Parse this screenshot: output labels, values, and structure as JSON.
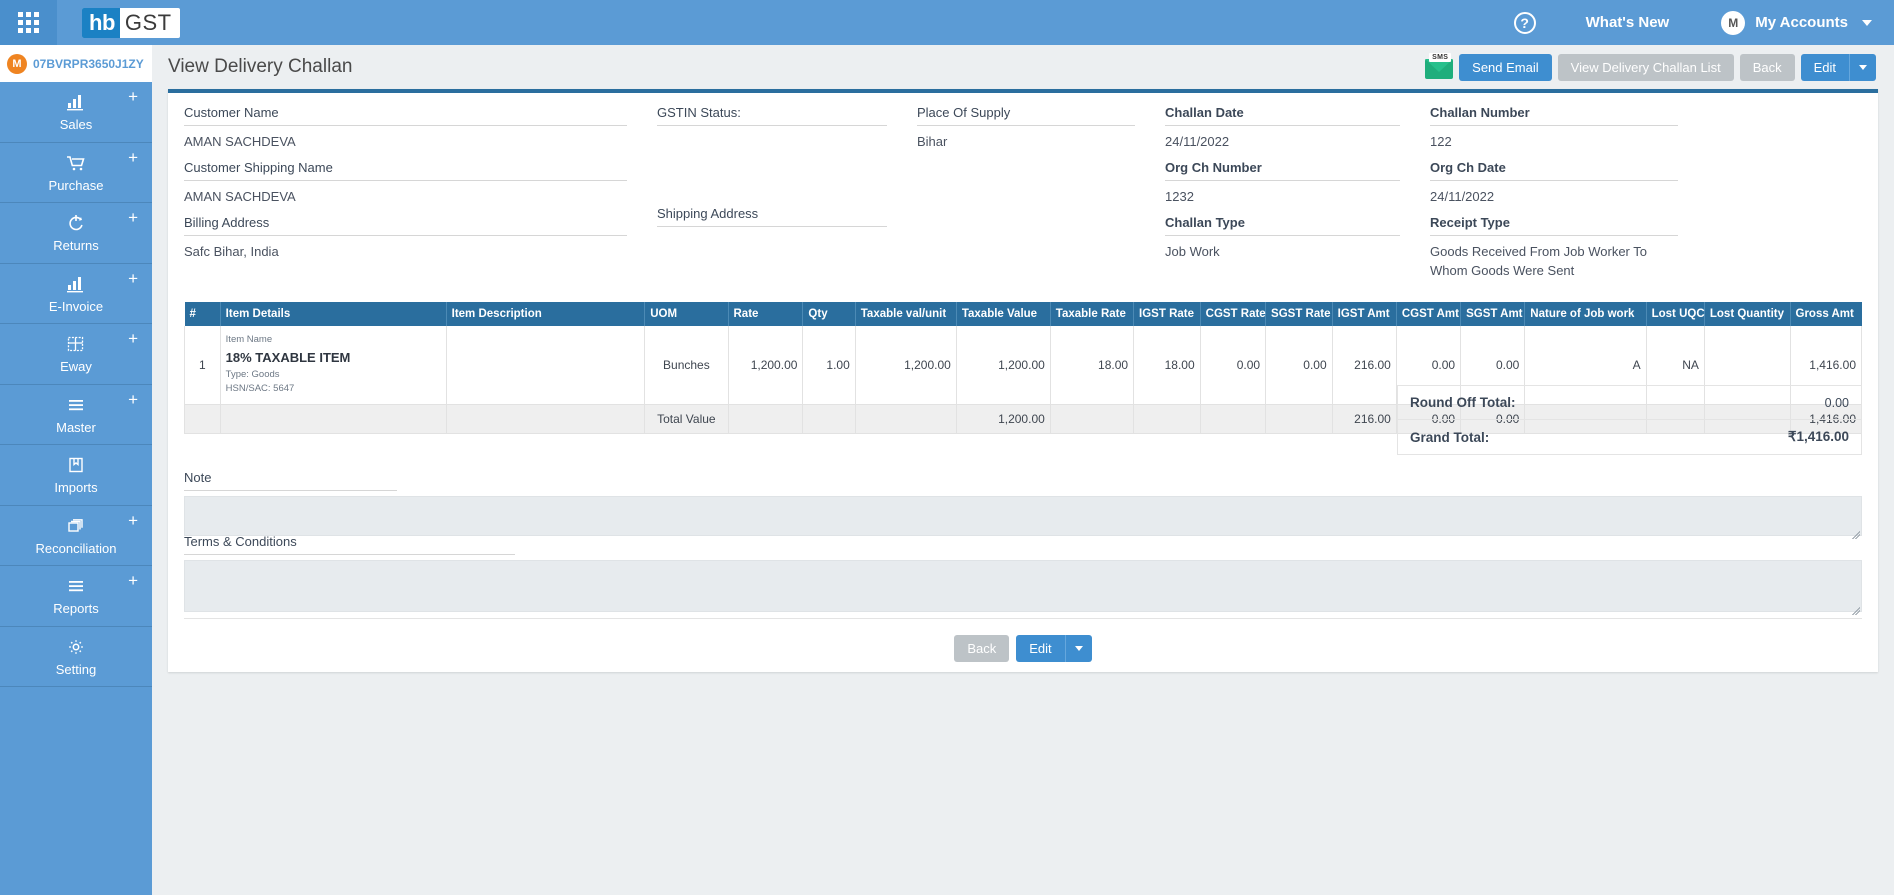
{
  "topbar": {
    "apps_icon": "grid-apps-icon",
    "logo_primary": "hb",
    "logo_secondary": "GST",
    "help_icon": "?",
    "whats_new": "What's New",
    "account_initial": "M",
    "account_label": "My Accounts",
    "accent": "#5b9bd5"
  },
  "sidebar": {
    "gstin": "07BVRPR3650J1ZY",
    "gstin_initial": "M",
    "items": [
      {
        "label": "Sales",
        "icon": "bar-chart-icon",
        "has_add": true
      },
      {
        "label": "Purchase",
        "icon": "cart-icon",
        "has_add": true
      },
      {
        "label": "Returns",
        "icon": "refresh-icon",
        "has_add": true
      },
      {
        "label": "E-Invoice",
        "icon": "bar-chart-icon",
        "has_add": true
      },
      {
        "label": "Eway",
        "icon": "grid-table-icon",
        "has_add": true
      },
      {
        "label": "Master",
        "icon": "hamburger-icon",
        "has_add": true
      },
      {
        "label": "Imports",
        "icon": "bookmark-icon",
        "has_add": false
      },
      {
        "label": "Reconciliation",
        "icon": "copy-icon",
        "has_add": true
      },
      {
        "label": "Reports",
        "icon": "hamburger-icon",
        "has_add": true
      },
      {
        "label": "Setting",
        "icon": "gear-icon",
        "has_add": false
      }
    ],
    "add_symbol": "+"
  },
  "header": {
    "title": "View Delivery Challan",
    "sms_badge": "SMS",
    "send_email": "Send Email",
    "view_list": "View Delivery Challan List",
    "back": "Back",
    "edit": "Edit"
  },
  "fields": {
    "customer_name_label": "Customer Name",
    "customer_name_value": "AMAN SACHDEVA",
    "customer_shipping_name_label": "Customer Shipping Name",
    "customer_shipping_name_value": "AMAN SACHDEVA",
    "billing_address_label": "Billing Address",
    "billing_address_value": "Safc Bihar, India",
    "gstin_status_label": "GSTIN Status:",
    "gstin_status_value": "",
    "shipping_address_label": "Shipping Address",
    "shipping_address_value": "",
    "place_of_supply_label": "Place Of Supply",
    "place_of_supply_value": "Bihar",
    "challan_date_label": "Challan Date",
    "challan_date_value": "24/11/2022",
    "org_ch_number_label": "Org Ch Number",
    "org_ch_number_value": "1232",
    "challan_type_label": "Challan Type",
    "challan_type_value": "Job Work",
    "challan_number_label": "Challan Number",
    "challan_number_value": "122",
    "org_ch_date_label": "Org Ch Date",
    "org_ch_date_value": "24/11/2022",
    "receipt_type_label": "Receipt Type",
    "receipt_type_value": "Goods Received From Job Worker To Whom Goods Were Sent"
  },
  "table": {
    "columns": [
      "#",
      "Item Details",
      "Item Description",
      "UOM",
      "Rate",
      "Qty",
      "Taxable val/unit",
      "Taxable Value",
      "Taxable Rate",
      "IGST Rate",
      "CGST Rate",
      "SGST Rate",
      "IGST Amt",
      "CGST Amt",
      "SGST Amt",
      "Nature of Job work",
      "Lost UQC",
      "Lost Quantity",
      "Gross Amt"
    ],
    "rows": [
      {
        "index": "1",
        "item_name_caption": "Item Name",
        "item_name": "18% TAXABLE ITEM",
        "item_type": "Type: Goods",
        "item_hsn": "HSN/SAC: 5647",
        "item_description": "",
        "uom": "Bunches",
        "rate": "1,200.00",
        "qty": "1.00",
        "taxable_val_unit": "1,200.00",
        "taxable_value": "1,200.00",
        "taxable_rate": "18.00",
        "igst_rate": "18.00",
        "cgst_rate": "0.00",
        "sgst_rate": "0.00",
        "igst_amt": "216.00",
        "cgst_amt": "0.00",
        "sgst_amt": "0.00",
        "nature_of_job_work": "A",
        "lost_uqc": "NA",
        "lost_quantity": "",
        "gross_amt": "1,416.00"
      }
    ],
    "totals": {
      "label": "Total Value",
      "taxable_value": "1,200.00",
      "igst_amt": "216.00",
      "cgst_amt": "0.00",
      "sgst_amt": "0.00",
      "gross_amt": "1,416.00"
    }
  },
  "summary": {
    "round_off_label": "Round Off Total:",
    "round_off_value": "0.00",
    "grand_total_label": "Grand Total:",
    "grand_total_value": "₹1,416.00"
  },
  "notes": {
    "note_label": "Note",
    "note_value": "",
    "terms_label": "Terms & Conditions",
    "terms_value": ""
  },
  "footer": {
    "back": "Back",
    "edit": "Edit"
  }
}
